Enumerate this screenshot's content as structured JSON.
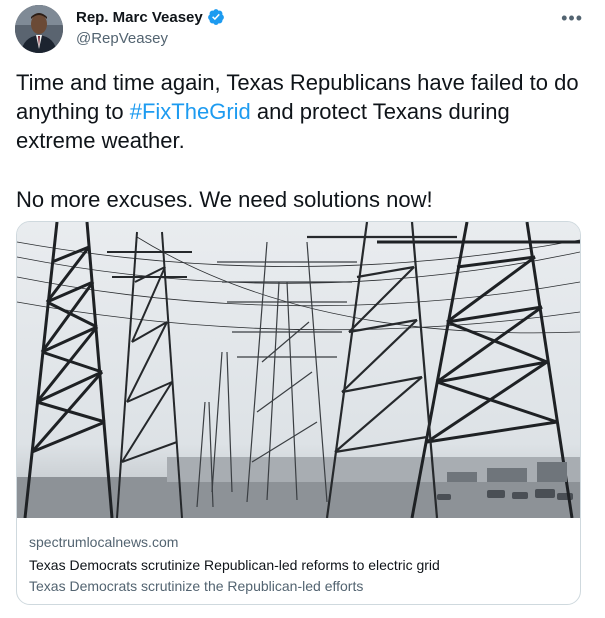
{
  "author": {
    "display_name": "Rep. Marc Veasey",
    "handle": "@RepVeasey",
    "verified": true
  },
  "tweet": {
    "text_part1": "Time and time again, Texas Republicans have failed to do anything to ",
    "hashtag": "#FixTheGrid",
    "text_part2": " and protect Texans during extreme weather.",
    "paragraph2": "No more excuses. We need solutions now!"
  },
  "card": {
    "domain": "spectrumlocalnews.com",
    "title": "Texas Democrats scrutinize Republican-led reforms to electric grid",
    "description": "Texas Democrats scrutinize the Republican-led efforts",
    "image_icon": "power-transmission-towers-photo"
  },
  "menu": {
    "more_icon": "more-options-icon",
    "more_glyph": "•••"
  },
  "colors": {
    "accent": "#1d9bf0",
    "text": "#0f1419",
    "secondary": "#536471",
    "border": "#cfd9de"
  }
}
